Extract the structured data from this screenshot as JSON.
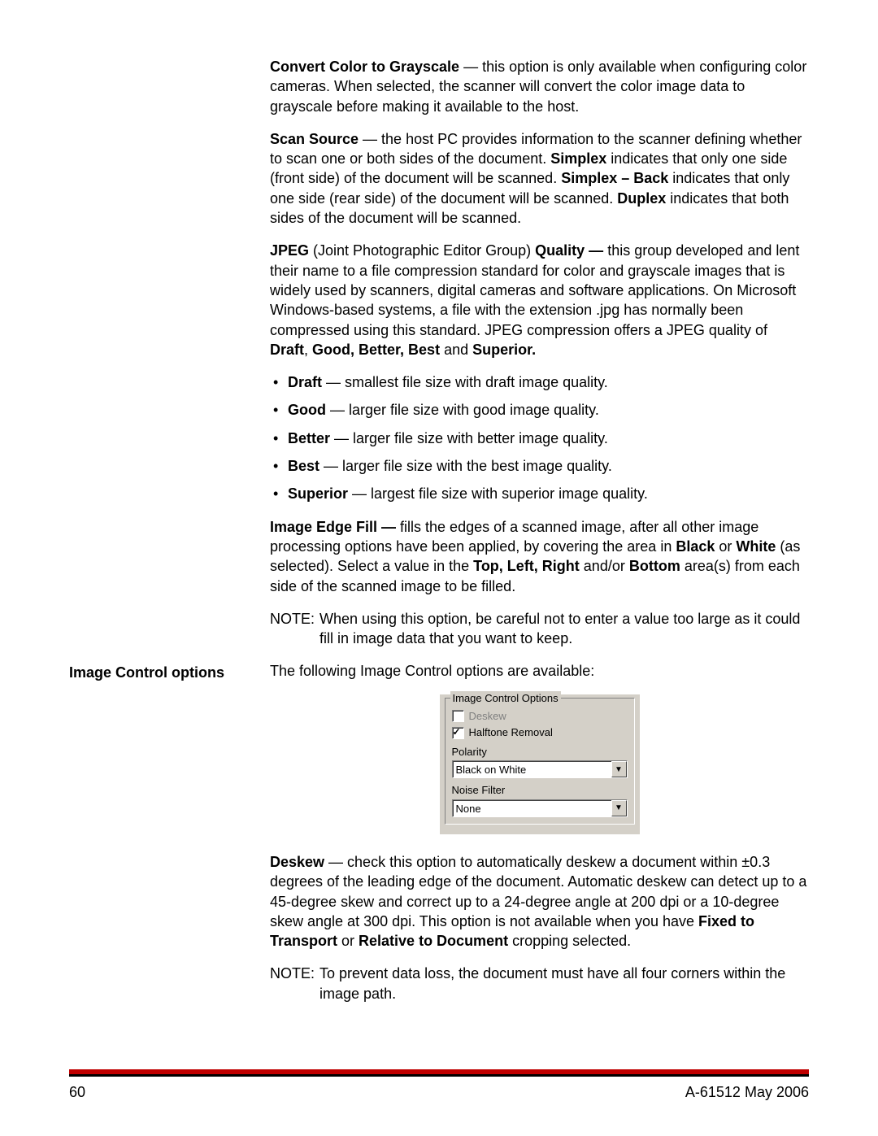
{
  "paragraphs": {
    "convert": {
      "bold": "Convert Color to Grayscale",
      "rest": " — this option is only available when configuring color cameras. When selected, the scanner will convert the color image data to grayscale before making it available to the host."
    },
    "scan_source": {
      "bold1": "Scan Source",
      "t1": " — the host PC provides information to the scanner defining whether to scan one or both sides of the document. ",
      "bold2": "Simplex",
      "t2": " indicates that only one side (front side) of the document will be scanned. ",
      "bold3": "Simplex – Back",
      "t3": " indicates that only one side (rear side) of the document will be scanned. ",
      "bold4": "Duplex",
      "t4": " indicates that both sides of the document will be scanned."
    },
    "jpeg": {
      "bold1": "JPEG",
      "t1": " (Joint Photographic Editor Group) ",
      "bold2": "Quality —",
      "t2": " this group developed and lent their name to a file compression standard for color and grayscale images that is widely used by scanners, digital cameras and software applications. On Microsoft Windows-based systems, a file with the extension .jpg has normally been compressed using this standard. JPEG compression offers a JPEG quality of ",
      "bold3": "Draft",
      "t3": ", ",
      "bold4": "Good, Better, Best",
      "t4": " and ",
      "bold5": "Superior."
    },
    "bullets": [
      {
        "bold": "Draft",
        "rest": " — smallest file size with draft image quality."
      },
      {
        "bold": "Good",
        "rest": " — larger file size with good image quality."
      },
      {
        "bold": "Better",
        "rest": " — larger file size with better image quality."
      },
      {
        "bold": "Best",
        "rest": " — larger file size with the best image quality."
      },
      {
        "bold": "Superior",
        "rest": " — largest file size with superior image quality."
      }
    ],
    "edge_fill": {
      "bold1": "Image Edge Fill —",
      "t1": " fills the edges of a scanned image, after all other image processing options have been applied, by covering the area in ",
      "bold2": "Black",
      "t2": " or ",
      "bold3": "White",
      "t3": " (as selected).  Select a value in the ",
      "bold4": "Top, Left, Right",
      "t4": " and/or ",
      "bold5": "Bottom",
      "t5": " area(s) from each side of the scanned image to be filled."
    },
    "note1": {
      "label": "NOTE:",
      "body": "When using this option, be careful not to enter a value too large as it could fill in image data that you want to keep."
    },
    "ic_heading": "Image Control options",
    "ic_intro": "The following Image Control options are available:",
    "deskew": {
      "bold1": "Deskew",
      "t1": " — check this option to automatically deskew a document within ±0.3 degrees of the leading edge of the document. Automatic deskew can detect up to a 45-degree skew and correct up to a 24-degree angle at 200 dpi or a 10-degree skew angle at 300 dpi. This option is not available when you have ",
      "bold2": "Fixed to Transport",
      "t2": " or ",
      "bold3": "Relative to Document",
      "t3": " cropping selected."
    },
    "note2": {
      "label": "NOTE:",
      "body": "To prevent data loss, the document must have all four corners within the image path."
    }
  },
  "win_panel": {
    "group_title": "Image Control Options",
    "deskew_label": "Deskew",
    "halftone_label": "Halftone Removal",
    "polarity_label": "Polarity",
    "polarity_value": "Black on White",
    "noise_label": "Noise Filter",
    "noise_value": "None"
  },
  "footer": {
    "page": "60",
    "doc": "A-61512  May 2006"
  }
}
